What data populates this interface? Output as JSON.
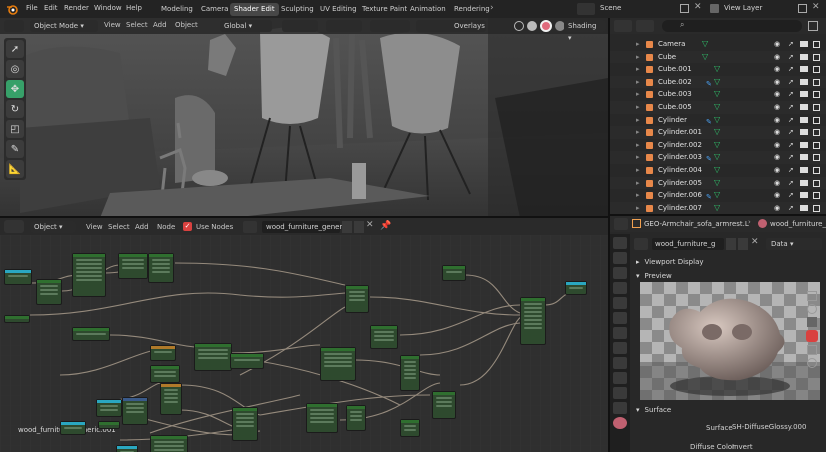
{
  "menus": [
    "File",
    "Edit",
    "Render",
    "Window",
    "Help"
  ],
  "workspaces": [
    "Modeling",
    "Camera",
    "Shader Edit",
    "Sculpting",
    "UV Editing",
    "Texture Paint",
    "Animation",
    "Rendering"
  ],
  "active_workspace": "Shader Edit",
  "scene_label": "Scene",
  "view_layer_label": "View Layer",
  "viewport": {
    "mode": "Object Mode",
    "menus": [
      "View",
      "Select",
      "Add",
      "Object"
    ],
    "transform": "Global",
    "overlays": "Overlays",
    "shading": "Shading"
  },
  "outliner": {
    "rows": [
      {
        "name": "Camera",
        "icon": "camera-icon",
        "color": "#e8884a"
      },
      {
        "name": "Cube",
        "icon": "mesh-icon",
        "color": "#e8884a"
      },
      {
        "name": "Cube.001",
        "icon": "mesh-icon",
        "color": "#e8884a"
      },
      {
        "name": "Cube.002",
        "icon": "mesh-icon",
        "color": "#e8884a"
      },
      {
        "name": "Cube.003",
        "icon": "mesh-icon",
        "color": "#e8884a"
      },
      {
        "name": "Cube.005",
        "icon": "mesh-icon",
        "color": "#e8884a"
      },
      {
        "name": "Cylinder",
        "icon": "mesh-icon",
        "color": "#e8884a"
      },
      {
        "name": "Cylinder.001",
        "icon": "mesh-icon",
        "color": "#e8884a"
      },
      {
        "name": "Cylinder.002",
        "icon": "mesh-icon",
        "color": "#e8884a"
      },
      {
        "name": "Cylinder.003",
        "icon": "mesh-icon",
        "color": "#e8884a"
      },
      {
        "name": "Cylinder.004",
        "icon": "mesh-icon",
        "color": "#e8884a"
      },
      {
        "name": "Cylinder.005",
        "icon": "mesh-icon",
        "color": "#e8884a"
      },
      {
        "name": "Cylinder.006",
        "icon": "mesh-icon",
        "color": "#e8884a"
      },
      {
        "name": "Cylinder.007",
        "icon": "mesh-icon",
        "color": "#e8884a"
      }
    ]
  },
  "node_editor": {
    "object_type": "Object",
    "menus": [
      "View",
      "Select",
      "Add",
      "Node"
    ],
    "use_nodes_label": "Use Nodes",
    "use_nodes_checked": true,
    "material_name": "wood_furniture_generi",
    "canvas_label": "wood_furniture_generic.001"
  },
  "properties": {
    "object_name": "GEO-Armchair_sofa_armrest.L",
    "material_short": "wood_furniture_ge",
    "material_field": "wood_furniture_g",
    "data_label": "Data",
    "sections": {
      "viewport_display": "Viewport Display",
      "preview": "Preview",
      "surface": "Surface"
    },
    "surface_label": "Surface",
    "surface_value": "SH-DiffuseGlossy.000",
    "diffuse_label": "Diffuse Color",
    "diffuse_value": "Invert"
  }
}
